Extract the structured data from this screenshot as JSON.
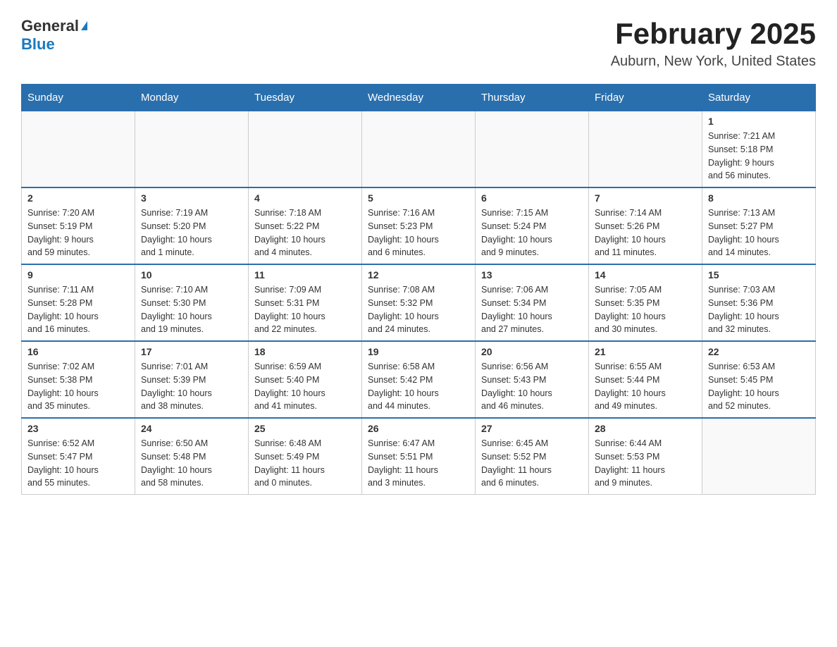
{
  "header": {
    "logo": {
      "general": "General",
      "blue": "Blue"
    },
    "title": "February 2025",
    "subtitle": "Auburn, New York, United States"
  },
  "days_of_week": [
    "Sunday",
    "Monday",
    "Tuesday",
    "Wednesday",
    "Thursday",
    "Friday",
    "Saturday"
  ],
  "weeks": [
    [
      {
        "day": "",
        "info": ""
      },
      {
        "day": "",
        "info": ""
      },
      {
        "day": "",
        "info": ""
      },
      {
        "day": "",
        "info": ""
      },
      {
        "day": "",
        "info": ""
      },
      {
        "day": "",
        "info": ""
      },
      {
        "day": "1",
        "info": "Sunrise: 7:21 AM\nSunset: 5:18 PM\nDaylight: 9 hours\nand 56 minutes."
      }
    ],
    [
      {
        "day": "2",
        "info": "Sunrise: 7:20 AM\nSunset: 5:19 PM\nDaylight: 9 hours\nand 59 minutes."
      },
      {
        "day": "3",
        "info": "Sunrise: 7:19 AM\nSunset: 5:20 PM\nDaylight: 10 hours\nand 1 minute."
      },
      {
        "day": "4",
        "info": "Sunrise: 7:18 AM\nSunset: 5:22 PM\nDaylight: 10 hours\nand 4 minutes."
      },
      {
        "day": "5",
        "info": "Sunrise: 7:16 AM\nSunset: 5:23 PM\nDaylight: 10 hours\nand 6 minutes."
      },
      {
        "day": "6",
        "info": "Sunrise: 7:15 AM\nSunset: 5:24 PM\nDaylight: 10 hours\nand 9 minutes."
      },
      {
        "day": "7",
        "info": "Sunrise: 7:14 AM\nSunset: 5:26 PM\nDaylight: 10 hours\nand 11 minutes."
      },
      {
        "day": "8",
        "info": "Sunrise: 7:13 AM\nSunset: 5:27 PM\nDaylight: 10 hours\nand 14 minutes."
      }
    ],
    [
      {
        "day": "9",
        "info": "Sunrise: 7:11 AM\nSunset: 5:28 PM\nDaylight: 10 hours\nand 16 minutes."
      },
      {
        "day": "10",
        "info": "Sunrise: 7:10 AM\nSunset: 5:30 PM\nDaylight: 10 hours\nand 19 minutes."
      },
      {
        "day": "11",
        "info": "Sunrise: 7:09 AM\nSunset: 5:31 PM\nDaylight: 10 hours\nand 22 minutes."
      },
      {
        "day": "12",
        "info": "Sunrise: 7:08 AM\nSunset: 5:32 PM\nDaylight: 10 hours\nand 24 minutes."
      },
      {
        "day": "13",
        "info": "Sunrise: 7:06 AM\nSunset: 5:34 PM\nDaylight: 10 hours\nand 27 minutes."
      },
      {
        "day": "14",
        "info": "Sunrise: 7:05 AM\nSunset: 5:35 PM\nDaylight: 10 hours\nand 30 minutes."
      },
      {
        "day": "15",
        "info": "Sunrise: 7:03 AM\nSunset: 5:36 PM\nDaylight: 10 hours\nand 32 minutes."
      }
    ],
    [
      {
        "day": "16",
        "info": "Sunrise: 7:02 AM\nSunset: 5:38 PM\nDaylight: 10 hours\nand 35 minutes."
      },
      {
        "day": "17",
        "info": "Sunrise: 7:01 AM\nSunset: 5:39 PM\nDaylight: 10 hours\nand 38 minutes."
      },
      {
        "day": "18",
        "info": "Sunrise: 6:59 AM\nSunset: 5:40 PM\nDaylight: 10 hours\nand 41 minutes."
      },
      {
        "day": "19",
        "info": "Sunrise: 6:58 AM\nSunset: 5:42 PM\nDaylight: 10 hours\nand 44 minutes."
      },
      {
        "day": "20",
        "info": "Sunrise: 6:56 AM\nSunset: 5:43 PM\nDaylight: 10 hours\nand 46 minutes."
      },
      {
        "day": "21",
        "info": "Sunrise: 6:55 AM\nSunset: 5:44 PM\nDaylight: 10 hours\nand 49 minutes."
      },
      {
        "day": "22",
        "info": "Sunrise: 6:53 AM\nSunset: 5:45 PM\nDaylight: 10 hours\nand 52 minutes."
      }
    ],
    [
      {
        "day": "23",
        "info": "Sunrise: 6:52 AM\nSunset: 5:47 PM\nDaylight: 10 hours\nand 55 minutes."
      },
      {
        "day": "24",
        "info": "Sunrise: 6:50 AM\nSunset: 5:48 PM\nDaylight: 10 hours\nand 58 minutes."
      },
      {
        "day": "25",
        "info": "Sunrise: 6:48 AM\nSunset: 5:49 PM\nDaylight: 11 hours\nand 0 minutes."
      },
      {
        "day": "26",
        "info": "Sunrise: 6:47 AM\nSunset: 5:51 PM\nDaylight: 11 hours\nand 3 minutes."
      },
      {
        "day": "27",
        "info": "Sunrise: 6:45 AM\nSunset: 5:52 PM\nDaylight: 11 hours\nand 6 minutes."
      },
      {
        "day": "28",
        "info": "Sunrise: 6:44 AM\nSunset: 5:53 PM\nDaylight: 11 hours\nand 9 minutes."
      },
      {
        "day": "",
        "info": ""
      }
    ]
  ]
}
